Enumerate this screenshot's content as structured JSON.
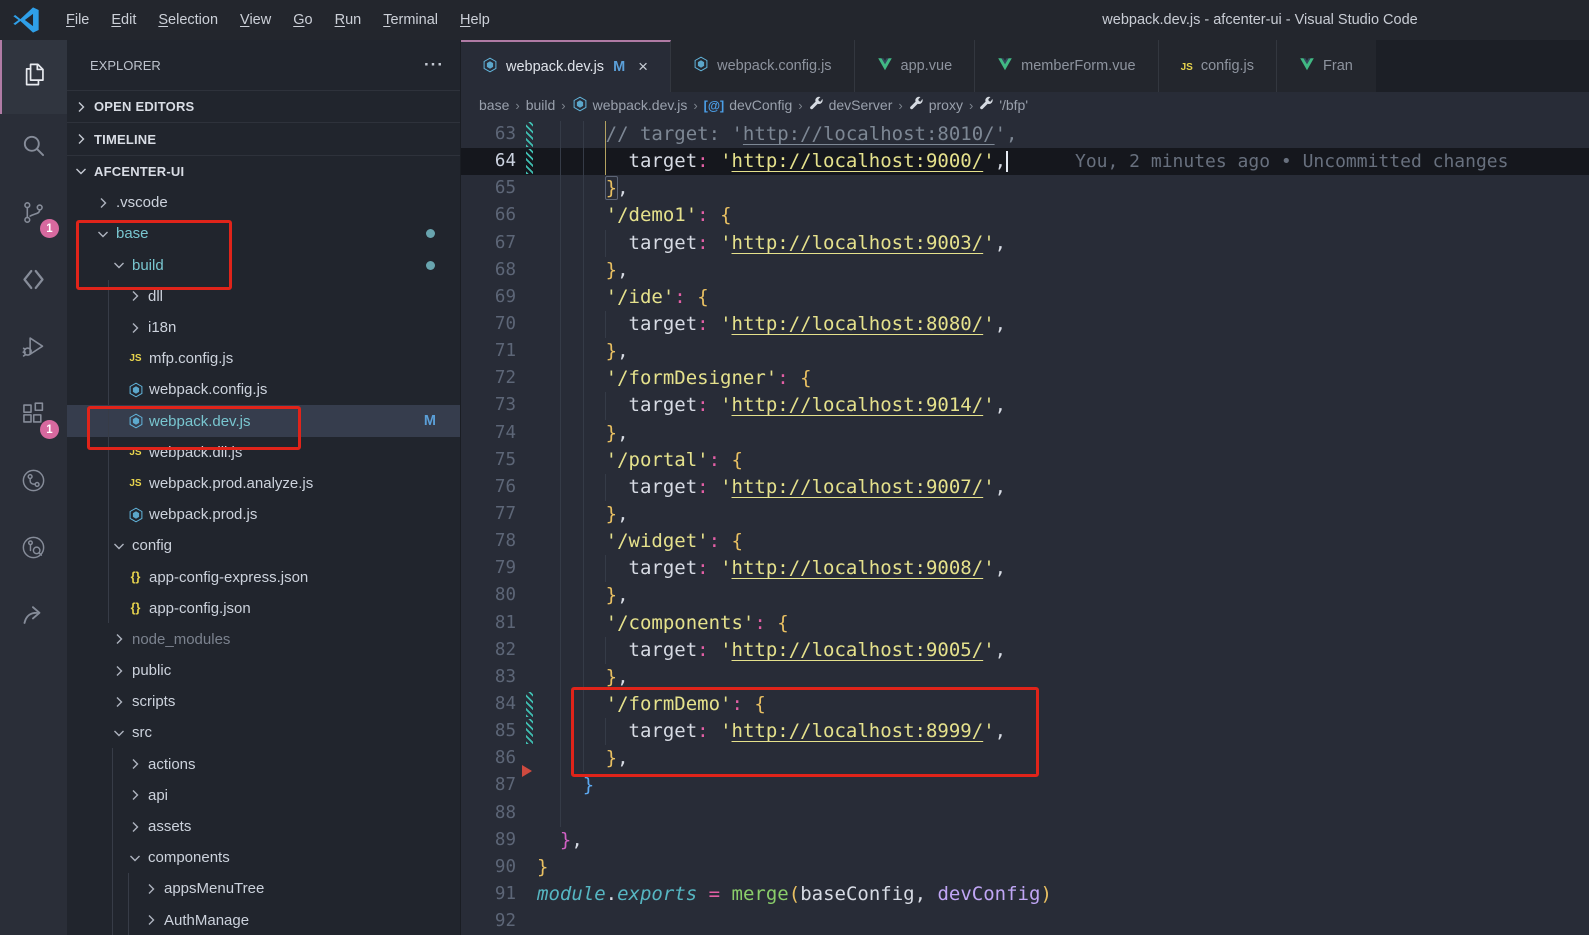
{
  "title_bar": {
    "title": "webpack.dev.js - afcenter-ui - Visual Studio Code",
    "menu": [
      "File",
      "Edit",
      "Selection",
      "View",
      "Go",
      "Run",
      "Terminal",
      "Help"
    ]
  },
  "activity_bar": {
    "items": [
      {
        "name": "explorer",
        "icon": "files",
        "active": true
      },
      {
        "name": "search",
        "icon": "search"
      },
      {
        "name": "source-control",
        "icon": "scm",
        "badge": "1"
      },
      {
        "name": "compare",
        "icon": "compare"
      },
      {
        "name": "run-and-debug",
        "icon": "debug"
      },
      {
        "name": "extensions",
        "icon": "ext",
        "badge": "1"
      },
      {
        "name": "git-graph",
        "icon": "gitgraph"
      },
      {
        "name": "commit-search",
        "icon": "gitlens"
      },
      {
        "name": "live-share",
        "icon": "share"
      }
    ]
  },
  "sidebar": {
    "header": "EXPLORER",
    "more": "···",
    "sections": [
      {
        "label": "OPEN EDITORS",
        "state": "collapsed"
      },
      {
        "label": "TIMELINE",
        "state": "collapsed"
      },
      {
        "label": "AFCENTER-UI",
        "state": "expanded"
      }
    ],
    "tree": [
      {
        "label": ".vscode",
        "level": 0,
        "kind": "folder",
        "state": "collapsed"
      },
      {
        "label": "base",
        "level": 0,
        "kind": "folder",
        "state": "expanded",
        "teal": true,
        "dot": true
      },
      {
        "label": "build",
        "level": 1,
        "kind": "folder",
        "state": "expanded",
        "teal": true,
        "dot": true
      },
      {
        "label": "dll",
        "level": 2,
        "kind": "folder",
        "state": "collapsed"
      },
      {
        "label": "i18n",
        "level": 2,
        "kind": "folder",
        "state": "collapsed"
      },
      {
        "label": "mfp.config.js",
        "level": 2,
        "kind": "file",
        "icon": "js"
      },
      {
        "label": "webpack.config.js",
        "level": 2,
        "kind": "file",
        "icon": "webpack"
      },
      {
        "label": "webpack.dev.js",
        "level": 2,
        "kind": "file",
        "icon": "webpack",
        "teal": true,
        "selected": true,
        "badge": "M"
      },
      {
        "label": "webpack.dll.js",
        "level": 2,
        "kind": "file",
        "icon": "js"
      },
      {
        "label": "webpack.prod.analyze.js",
        "level": 2,
        "kind": "file",
        "icon": "js"
      },
      {
        "label": "webpack.prod.js",
        "level": 2,
        "kind": "file",
        "icon": "webpack"
      },
      {
        "label": "config",
        "level": 1,
        "kind": "folder",
        "state": "expanded"
      },
      {
        "label": "app-config-express.json",
        "level": 2,
        "kind": "file",
        "icon": "json"
      },
      {
        "label": "app-config.json",
        "level": 2,
        "kind": "file",
        "icon": "json"
      },
      {
        "label": "node_modules",
        "level": 1,
        "kind": "folder",
        "state": "collapsed",
        "dim": true
      },
      {
        "label": "public",
        "level": 1,
        "kind": "folder",
        "state": "collapsed"
      },
      {
        "label": "scripts",
        "level": 1,
        "kind": "folder",
        "state": "collapsed"
      },
      {
        "label": "src",
        "level": 1,
        "kind": "folder",
        "state": "expanded"
      },
      {
        "label": "actions",
        "level": 2,
        "kind": "folder",
        "state": "collapsed"
      },
      {
        "label": "api",
        "level": 2,
        "kind": "folder",
        "state": "collapsed"
      },
      {
        "label": "assets",
        "level": 2,
        "kind": "folder",
        "state": "collapsed"
      },
      {
        "label": "components",
        "level": 2,
        "kind": "folder",
        "state": "expanded"
      },
      {
        "label": "appsMenuTree",
        "level": 3,
        "kind": "folder",
        "state": "collapsed"
      },
      {
        "label": "AuthManage",
        "level": 3,
        "kind": "folder",
        "state": "collapsed"
      }
    ]
  },
  "tabs": [
    {
      "label": "webpack.dev.js",
      "icon": "webpack",
      "modified": "M",
      "close": "×",
      "active": true
    },
    {
      "label": "webpack.config.js",
      "icon": "webpack"
    },
    {
      "label": "app.vue",
      "icon": "vue"
    },
    {
      "label": "memberForm.vue",
      "icon": "vue"
    },
    {
      "label": "config.js",
      "icon": "js"
    },
    {
      "label": "Fran",
      "icon": "vue",
      "truncated": true
    }
  ],
  "breadcrumb": {
    "separator": "›",
    "items": [
      {
        "label": "base"
      },
      {
        "label": "build"
      },
      {
        "label": "webpack.dev.js",
        "icon": "webpack"
      },
      {
        "label": "devConfig",
        "icon": "symvar"
      },
      {
        "label": "devServer",
        "icon": "wrench"
      },
      {
        "label": "proxy",
        "icon": "wrench"
      },
      {
        "label": "'/bfp'",
        "icon": "wrench"
      }
    ]
  },
  "editor": {
    "blame": "You, 2 minutes ago • Uncommitted changes",
    "lines": [
      {
        "n": 63,
        "mark": "mod",
        "guides": [
          2,
          4
        ],
        "ag": 6,
        "tokens": [
          [
            "      ",
            "w"
          ],
          [
            "// target: '",
            "cm"
          ],
          [
            "http://localhost:8010/",
            "cmu"
          ],
          [
            "',",
            "cm"
          ]
        ]
      },
      {
        "n": 64,
        "mark": "mod",
        "current": true,
        "guides": [
          2,
          4
        ],
        "ag": 6,
        "cursor": true,
        "blame": true,
        "tokens": [
          [
            "        ",
            "w"
          ],
          [
            "target",
            "w"
          ],
          [
            ":",
            "p"
          ],
          [
            " ",
            "w"
          ],
          [
            "'",
            "s"
          ],
          [
            "http://localhost:9000/",
            "su"
          ],
          [
            "'",
            "s"
          ],
          [
            ",",
            "w"
          ]
        ]
      },
      {
        "n": 65,
        "guides": [
          2,
          4
        ],
        "tokens": [
          [
            "      ",
            "w"
          ],
          [
            "}",
            "g bm"
          ],
          [
            ",",
            "w"
          ]
        ]
      },
      {
        "n": 66,
        "guides": [
          2,
          4
        ],
        "tokens": [
          [
            "      ",
            "w"
          ],
          [
            "'/demo1'",
            "s"
          ],
          [
            ":",
            "p"
          ],
          [
            " ",
            "w"
          ],
          [
            "{",
            "g"
          ]
        ]
      },
      {
        "n": 67,
        "guides": [
          2,
          4,
          6
        ],
        "tokens": [
          [
            "        ",
            "w"
          ],
          [
            "target",
            "w"
          ],
          [
            ":",
            "p"
          ],
          [
            " ",
            "w"
          ],
          [
            "'",
            "s"
          ],
          [
            "http://localhost:9003/",
            "su"
          ],
          [
            "'",
            "s"
          ],
          [
            ",",
            "w"
          ]
        ]
      },
      {
        "n": 68,
        "guides": [
          2,
          4
        ],
        "tokens": [
          [
            "      ",
            "w"
          ],
          [
            "}",
            "g"
          ],
          [
            ",",
            "w"
          ]
        ]
      },
      {
        "n": 69,
        "guides": [
          2,
          4
        ],
        "tokens": [
          [
            "      ",
            "w"
          ],
          [
            "'/ide'",
            "s"
          ],
          [
            ":",
            "p"
          ],
          [
            " ",
            "w"
          ],
          [
            "{",
            "g"
          ]
        ]
      },
      {
        "n": 70,
        "guides": [
          2,
          4,
          6
        ],
        "tokens": [
          [
            "        ",
            "w"
          ],
          [
            "target",
            "w"
          ],
          [
            ":",
            "p"
          ],
          [
            " ",
            "w"
          ],
          [
            "'",
            "s"
          ],
          [
            "http://localhost:8080/",
            "su"
          ],
          [
            "'",
            "s"
          ],
          [
            ",",
            "w"
          ]
        ]
      },
      {
        "n": 71,
        "guides": [
          2,
          4
        ],
        "tokens": [
          [
            "      ",
            "w"
          ],
          [
            "}",
            "g"
          ],
          [
            ",",
            "w"
          ]
        ]
      },
      {
        "n": 72,
        "guides": [
          2,
          4
        ],
        "tokens": [
          [
            "      ",
            "w"
          ],
          [
            "'/formDesigner'",
            "s"
          ],
          [
            ":",
            "p"
          ],
          [
            " ",
            "w"
          ],
          [
            "{",
            "g"
          ]
        ]
      },
      {
        "n": 73,
        "guides": [
          2,
          4,
          6
        ],
        "tokens": [
          [
            "        ",
            "w"
          ],
          [
            "target",
            "w"
          ],
          [
            ":",
            "p"
          ],
          [
            " ",
            "w"
          ],
          [
            "'",
            "s"
          ],
          [
            "http://localhost:9014/",
            "su"
          ],
          [
            "'",
            "s"
          ],
          [
            ",",
            "w"
          ]
        ]
      },
      {
        "n": 74,
        "guides": [
          2,
          4
        ],
        "tokens": [
          [
            "      ",
            "w"
          ],
          [
            "}",
            "g"
          ],
          [
            ",",
            "w"
          ]
        ]
      },
      {
        "n": 75,
        "guides": [
          2,
          4
        ],
        "tokens": [
          [
            "      ",
            "w"
          ],
          [
            "'/portal'",
            "s"
          ],
          [
            ":",
            "p"
          ],
          [
            " ",
            "w"
          ],
          [
            "{",
            "g"
          ]
        ]
      },
      {
        "n": 76,
        "guides": [
          2,
          4,
          6
        ],
        "tokens": [
          [
            "        ",
            "w"
          ],
          [
            "target",
            "w"
          ],
          [
            ":",
            "p"
          ],
          [
            " ",
            "w"
          ],
          [
            "'",
            "s"
          ],
          [
            "http://localhost:9007/",
            "su"
          ],
          [
            "'",
            "s"
          ],
          [
            ",",
            "w"
          ]
        ]
      },
      {
        "n": 77,
        "guides": [
          2,
          4
        ],
        "tokens": [
          [
            "      ",
            "w"
          ],
          [
            "}",
            "g"
          ],
          [
            ",",
            "w"
          ]
        ]
      },
      {
        "n": 78,
        "guides": [
          2,
          4
        ],
        "tokens": [
          [
            "      ",
            "w"
          ],
          [
            "'/widget'",
            "s"
          ],
          [
            ":",
            "p"
          ],
          [
            " ",
            "w"
          ],
          [
            "{",
            "g"
          ]
        ]
      },
      {
        "n": 79,
        "guides": [
          2,
          4,
          6
        ],
        "tokens": [
          [
            "        ",
            "w"
          ],
          [
            "target",
            "w"
          ],
          [
            ":",
            "p"
          ],
          [
            " ",
            "w"
          ],
          [
            "'",
            "s"
          ],
          [
            "http://localhost:9008/",
            "su"
          ],
          [
            "'",
            "s"
          ],
          [
            ",",
            "w"
          ]
        ]
      },
      {
        "n": 80,
        "guides": [
          2,
          4
        ],
        "tokens": [
          [
            "      ",
            "w"
          ],
          [
            "}",
            "g"
          ],
          [
            ",",
            "w"
          ]
        ]
      },
      {
        "n": 81,
        "guides": [
          2,
          4
        ],
        "tokens": [
          [
            "      ",
            "w"
          ],
          [
            "'/components'",
            "s"
          ],
          [
            ":",
            "p"
          ],
          [
            " ",
            "w"
          ],
          [
            "{",
            "g"
          ]
        ]
      },
      {
        "n": 82,
        "guides": [
          2,
          4,
          6
        ],
        "tokens": [
          [
            "        ",
            "w"
          ],
          [
            "target",
            "w"
          ],
          [
            ":",
            "p"
          ],
          [
            " ",
            "w"
          ],
          [
            "'",
            "s"
          ],
          [
            "http://localhost:9005/",
            "su"
          ],
          [
            "'",
            "s"
          ],
          [
            ",",
            "w"
          ]
        ]
      },
      {
        "n": 83,
        "guides": [
          2,
          4
        ],
        "tokens": [
          [
            "      ",
            "w"
          ],
          [
            "}",
            "g"
          ],
          [
            ",",
            "w"
          ]
        ]
      },
      {
        "n": 84,
        "mark": "mod",
        "guides": [
          2,
          4
        ],
        "tokens": [
          [
            "      ",
            "w"
          ],
          [
            "'/formDemo'",
            "s"
          ],
          [
            ":",
            "p"
          ],
          [
            " ",
            "w"
          ],
          [
            "{",
            "g"
          ]
        ]
      },
      {
        "n": 85,
        "mark": "mod",
        "guides": [
          2,
          4,
          6
        ],
        "tokens": [
          [
            "        ",
            "w"
          ],
          [
            "target",
            "w"
          ],
          [
            ":",
            "p"
          ],
          [
            " ",
            "w"
          ],
          [
            "'",
            "s"
          ],
          [
            "http://localhost:8999/",
            "su"
          ],
          [
            "'",
            "s"
          ],
          [
            ",",
            "w"
          ]
        ]
      },
      {
        "n": 86,
        "guides": [
          2,
          4
        ],
        "tokens": [
          [
            "      ",
            "w"
          ],
          [
            "}",
            "g"
          ],
          [
            ",",
            "w"
          ]
        ]
      },
      {
        "n": 87,
        "mark": "del",
        "guides": [
          2
        ],
        "tokens": [
          [
            "    ",
            "w"
          ],
          [
            "}",
            "b"
          ]
        ]
      },
      {
        "n": 88,
        "guides": [
          2
        ],
        "tokens": []
      },
      {
        "n": 89,
        "tokens": [
          [
            "  ",
            "w"
          ],
          [
            "}",
            "m"
          ],
          [
            ",",
            "w"
          ]
        ]
      },
      {
        "n": 90,
        "tokens": [
          [
            "}",
            "g"
          ]
        ]
      },
      {
        "n": 91,
        "tokens": [
          [
            "module",
            "cy"
          ],
          [
            ".",
            "w"
          ],
          [
            "exports",
            "cy"
          ],
          [
            " ",
            "w"
          ],
          [
            "=",
            "p"
          ],
          [
            " ",
            "w"
          ],
          [
            "merge",
            "gr"
          ],
          [
            "(",
            "g"
          ],
          [
            "baseConfig",
            "w"
          ],
          [
            ",",
            "w"
          ],
          [
            " ",
            "w"
          ],
          [
            "devConfig",
            "lv"
          ],
          [
            ")",
            "g"
          ]
        ]
      },
      {
        "n": 92,
        "tokens": []
      }
    ]
  }
}
